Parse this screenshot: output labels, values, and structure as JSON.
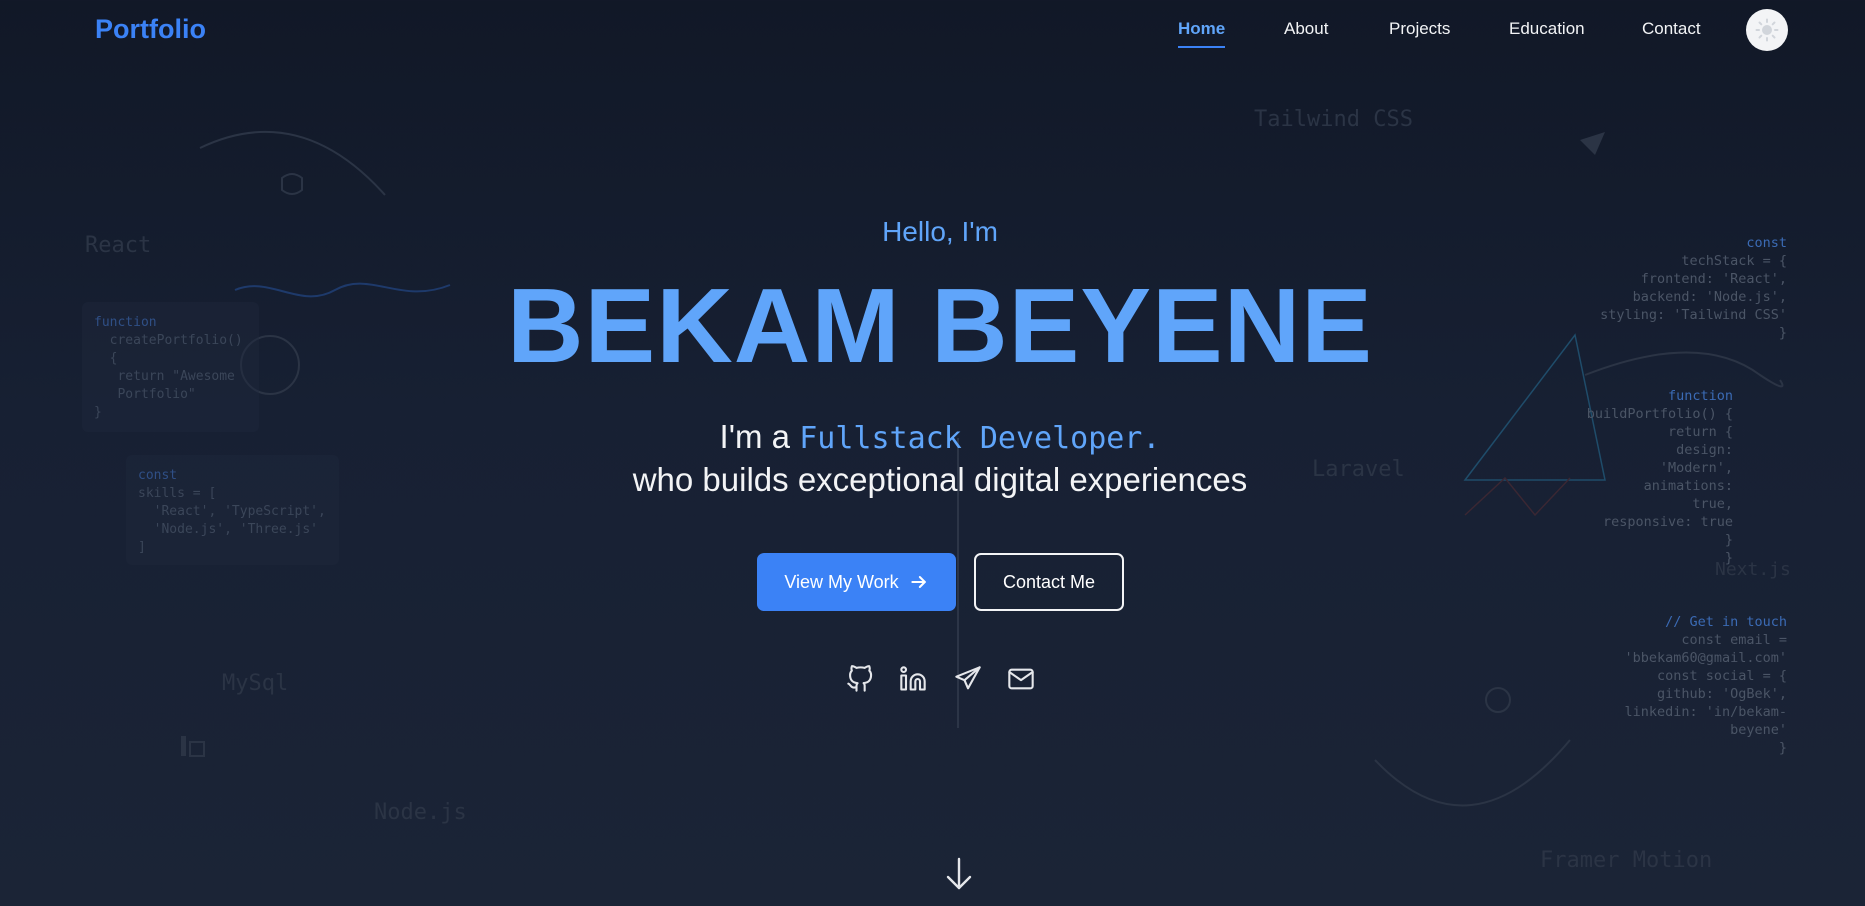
{
  "nav": {
    "brand": "Portfolio",
    "links": [
      {
        "label": "Home",
        "active": true
      },
      {
        "label": "About"
      },
      {
        "label": "Projects"
      },
      {
        "label": "Education"
      },
      {
        "label": "Contact"
      }
    ],
    "theme_toggle_icon": "sun-icon"
  },
  "hero": {
    "greeting": "Hello, I'm",
    "name": "BEKAM BEYENE",
    "tagline_prefix": "I'm a",
    "role": "Fullstack Developer.",
    "tagline_rest": "who builds exceptional digital experiences",
    "primary_button": "View My Work",
    "secondary_button": "Contact Me",
    "social_icons": [
      "github-icon",
      "linkedin-icon",
      "telegram-icon",
      "mail-icon"
    ]
  },
  "background": {
    "words": [
      "Tailwind CSS",
      "React",
      "MySql",
      "Node.js",
      "Laravel",
      "Next.js",
      "Framer Motion"
    ],
    "card_left_top": {
      "kw": "function",
      "lines": [
        "  createPortfolio()",
        "  {",
        "   return \"Awesome",
        "   Portfolio\"",
        "}"
      ]
    },
    "card_left_bottom": {
      "kw": "const",
      "lines": [
        "skills = [",
        "  'React', 'TypeScript',",
        "  'Node.js', 'Three.js'",
        "]"
      ]
    },
    "code_right_1": {
      "kw": "const",
      "lines": [
        "techStack = {",
        "frontend: 'React',",
        "backend: 'Node.js',",
        "styling: 'Tailwind CSS'",
        "}"
      ]
    },
    "code_right_2": {
      "kw": "function",
      "lines": [
        "buildPortfolio() {",
        "return {",
        "design:",
        "'Modern',",
        "animations:",
        "true,",
        "responsive: true",
        "}",
        "}"
      ]
    },
    "code_right_3": {
      "kw": "// Get in touch",
      "lines": [
        "const email =",
        "'bbekam60@gmail.com'",
        "const social = {",
        "github: 'OgBek',",
        "linkedin: 'in/bekam-",
        "beyene'",
        "}"
      ]
    }
  },
  "colors": {
    "accent": "#3b82f6",
    "accent_light": "#60a5fa",
    "background": "#111827"
  }
}
